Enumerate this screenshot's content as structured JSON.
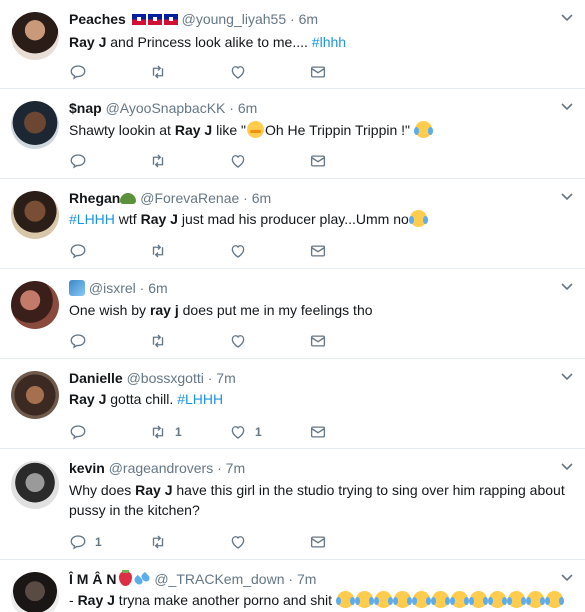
{
  "colors": {
    "link": "#1b95e0",
    "text": "#14171a",
    "muted": "#657786",
    "divider": "#e6ecf0"
  },
  "tweets": [
    {
      "name": "Peaches",
      "handle": "@young_liyah55",
      "time": "6m",
      "body": [
        "Ray J",
        " and Princess look alike to me.... ",
        "#lhhh"
      ],
      "reply_count": "",
      "retweet_count": "",
      "like_count": ""
    },
    {
      "name": "$nap",
      "handle": "@AyooSnapbacKK",
      "time": "6m",
      "body": [
        "Shawty lookin at ",
        "Ray J",
        " like \"",
        "Oh He Trippin Trippin !\" "
      ],
      "reply_count": "",
      "retweet_count": "",
      "like_count": ""
    },
    {
      "name": "Rhegan",
      "handle": "@ForevaRenae",
      "time": "6m",
      "body": [
        "#LHHH",
        " wtf ",
        "Ray J",
        " just mad his producer play...Umm no"
      ],
      "reply_count": "",
      "retweet_count": "",
      "like_count": ""
    },
    {
      "name": "",
      "handle": "@isxrel",
      "time": "6m",
      "body": [
        "One wish by ",
        "ray j",
        " does put me in my feelings tho"
      ],
      "reply_count": "",
      "retweet_count": "",
      "like_count": ""
    },
    {
      "name": "Danielle",
      "handle": "@bossxgotti",
      "time": "7m",
      "body": [
        "Ray J",
        " gotta chill. ",
        "#LHHH"
      ],
      "reply_count": "",
      "retweet_count": "1",
      "like_count": "1"
    },
    {
      "name": "kevin",
      "handle": "@rageandrovers",
      "time": "7m",
      "body": [
        "Why does ",
        "Ray J",
        " have this girl in the studio trying to sing over him rapping about pussy in the kitchen?"
      ],
      "reply_count": "1",
      "retweet_count": "",
      "like_count": ""
    },
    {
      "name": "Î M Â N",
      "handle": "@_TRACKem_down",
      "time": "7m",
      "body": [
        "- ",
        "Ray J",
        " tryna make another porno and shit "
      ],
      "reply_count": "",
      "retweet_count": "",
      "like_count": ""
    }
  ]
}
